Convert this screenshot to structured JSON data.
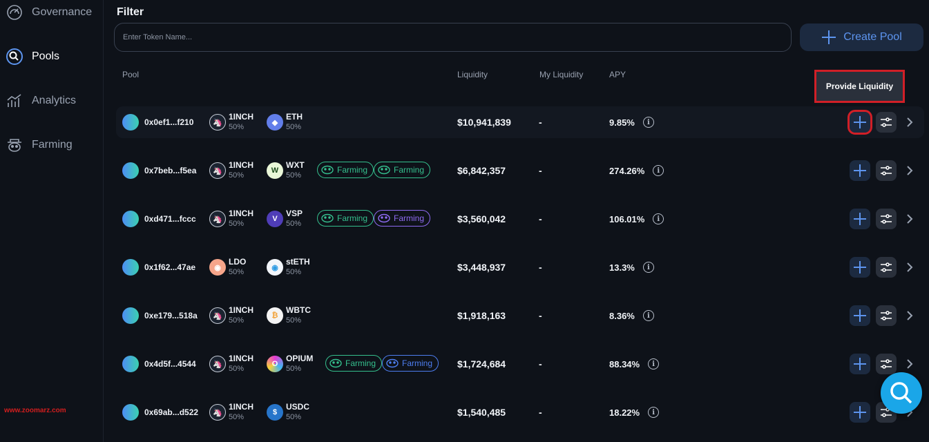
{
  "sidebar": {
    "items": [
      {
        "label": "Governance",
        "icon": "gauge-icon"
      },
      {
        "label": "Pools",
        "icon": "pools-icon",
        "active": true
      },
      {
        "label": "Analytics",
        "icon": "analytics-icon"
      },
      {
        "label": "Farming",
        "icon": "farming-icon"
      }
    ]
  },
  "watermark": "www.zoomarz.com",
  "filter": {
    "title": "Filter",
    "placeholder": "Enter Token Name...",
    "create_label": "Create Pool"
  },
  "columns": {
    "pool": "Pool",
    "liquidity": "Liquidity",
    "my_liquidity": "My Liquidity",
    "apy": "APY"
  },
  "annotation": {
    "provide_liquidity": "Provide Liquidity"
  },
  "colors": {
    "accent": "#5d95f0",
    "annotation_red": "#d11f27",
    "farming_green": "#35c08e",
    "vsp_purple": "#8f6bf2",
    "opium_blue": "#4d7ef0"
  },
  "pools": [
    {
      "address": "0x0ef1...f210",
      "token1": {
        "name": "1INCH",
        "pct": "50%",
        "icon": "1inch-icon"
      },
      "token2": {
        "name": "ETH",
        "pct": "50%",
        "icon": "eth-icon"
      },
      "badges": [],
      "liquidity": "$10,941,839",
      "my_liquidity": "-",
      "apy": "9.85%"
    },
    {
      "address": "0x7beb...f5ea",
      "token1": {
        "name": "1INCH",
        "pct": "50%",
        "icon": "1inch-icon"
      },
      "token2": {
        "name": "WXT",
        "pct": "50%",
        "icon": "wxt-icon"
      },
      "badges": [
        {
          "label": "Farming",
          "color": "#35c08e",
          "icon": "1inch-farm-icon"
        },
        {
          "label": "Farming",
          "color": "#35c08e",
          "icon": "wxt-farm-icon"
        }
      ],
      "liquidity": "$6,842,357",
      "my_liquidity": "-",
      "apy": "274.26%"
    },
    {
      "address": "0xd471...fccc",
      "token1": {
        "name": "1INCH",
        "pct": "50%",
        "icon": "1inch-icon"
      },
      "token2": {
        "name": "VSP",
        "pct": "50%",
        "icon": "vsp-icon"
      },
      "badges": [
        {
          "label": "Farming",
          "color": "#35c08e",
          "icon": "1inch-farm-icon"
        },
        {
          "label": "Farming",
          "color": "#8f6bf2",
          "icon": "vsp-farm-icon"
        }
      ],
      "liquidity": "$3,560,042",
      "my_liquidity": "-",
      "apy": "106.01%"
    },
    {
      "address": "0x1f62...47ae",
      "token1": {
        "name": "LDO",
        "pct": "50%",
        "icon": "ldo-icon"
      },
      "token2": {
        "name": "stETH",
        "pct": "50%",
        "icon": "steth-icon"
      },
      "badges": [],
      "liquidity": "$3,448,937",
      "my_liquidity": "-",
      "apy": "13.3%"
    },
    {
      "address": "0xe179...518a",
      "token1": {
        "name": "1INCH",
        "pct": "50%",
        "icon": "1inch-icon"
      },
      "token2": {
        "name": "WBTC",
        "pct": "50%",
        "icon": "wbtc-icon"
      },
      "badges": [],
      "liquidity": "$1,918,163",
      "my_liquidity": "-",
      "apy": "8.36%"
    },
    {
      "address": "0x4d5f...4544",
      "token1": {
        "name": "1INCH",
        "pct": "50%",
        "icon": "1inch-icon"
      },
      "token2": {
        "name": "OPIUM",
        "pct": "50%",
        "icon": "opium-icon"
      },
      "badges": [
        {
          "label": "Farming",
          "color": "#35c08e",
          "icon": "1inch-farm-icon"
        },
        {
          "label": "Farming",
          "color": "#4d7ef0",
          "icon": "opium-farm-icon"
        }
      ],
      "liquidity": "$1,724,684",
      "my_liquidity": "-",
      "apy": "88.34%"
    },
    {
      "address": "0x69ab...d522",
      "token1": {
        "name": "1INCH",
        "pct": "50%",
        "icon": "1inch-icon"
      },
      "token2": {
        "name": "USDC",
        "pct": "50%",
        "icon": "usdc-icon"
      },
      "badges": [],
      "liquidity": "$1,540,485",
      "my_liquidity": "-",
      "apy": "18.22%"
    }
  ]
}
